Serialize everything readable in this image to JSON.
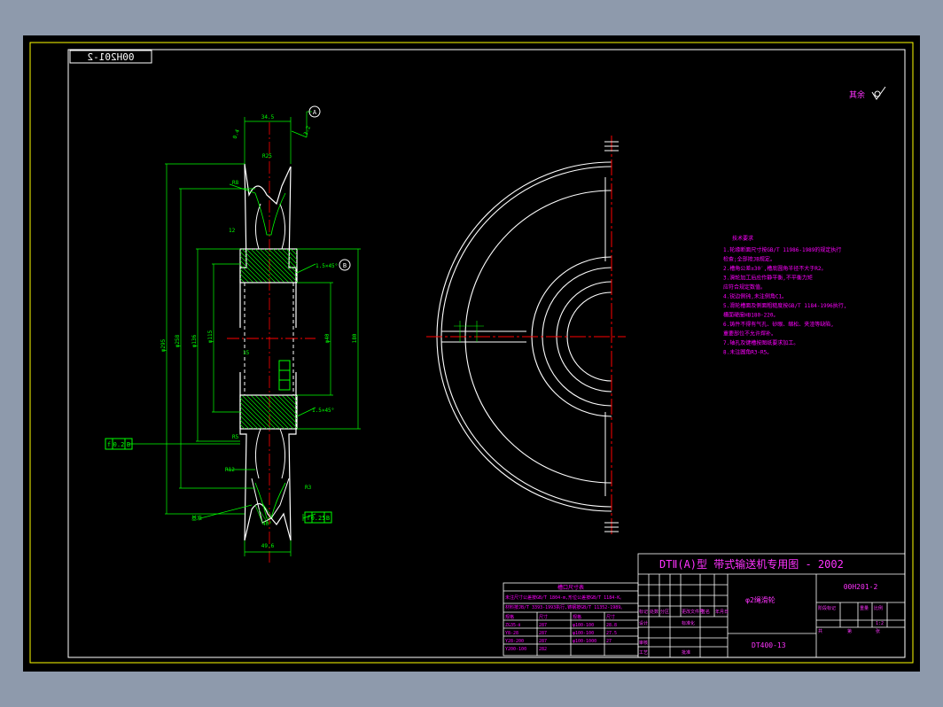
{
  "colors": {
    "background": "#8e9aac",
    "canvas": "#000000",
    "frame": "#ffff00",
    "outline": "#ffffff",
    "dimension": "#00ff00",
    "centerline": "#ff0000",
    "hatch": "#00ff00",
    "title_text": "#ff33ff",
    "notes_text": "#ff00ff"
  },
  "drawing": {
    "code_box": "00H201-2",
    "roughness_symbol_label": "其余",
    "datum_a": "A",
    "datum_b": "B",
    "gauge_label": "基准",
    "notes_title": "技术要求",
    "notes": [
      "1.轮缘断面尺寸按GB/T 11986-1989的规定执行",
      "  检查;全部按JB规定。",
      "2.槽角公差±30′,槽底圆角半径不大于R2。",
      "3.滑轮加工后应作静平衡,不平衡力矩",
      "  应符合规定数值。",
      "4.锐边倒钝,未注倒角C1。",
      "5.滑轮槽面及侧面粗糙度按GB/T 1184-1996执行,",
      "  槽面硬度HB180-220。",
      "6.铸件不得有气孔、砂眼、缩松、夹渣等缺陷,",
      "  重要部位不允许焊补。",
      "7.轴孔及键槽按图纸要求加工。",
      "8.未注圆角R3-R5。"
    ],
    "table_title": "槽口尺寸表",
    "table_notes": [
      "未注尺寸公差按GB/T 1804-m,形位公差按GB/T 1184-K。",
      "材料按JB/T 3393-1993执行,铸钢按GB/T 11352-1989。"
    ],
    "table_headers": [
      "规格",
      "尺寸",
      "规格",
      "尺寸"
    ],
    "table_rows": [
      [
        "ZG35-Ⅱ",
        "287",
        "φ100-100",
        "28.8"
      ],
      [
        "Y8-28",
        "287",
        "φ100-100",
        "27.5"
      ],
      [
        "Y28-200",
        "287",
        "φ100-1000",
        "27"
      ],
      [
        "Y200-100",
        "282",
        ""
      ]
    ],
    "title_main": "DTⅡ(A)型  带式输送机专用图 - 2002",
    "drawing_number": "00H201-2",
    "part_name": "φ2绳滑轮",
    "model_code": "DT400-13",
    "scale": "1:2",
    "title_labels": {
      "mark": "标记",
      "count": "处数",
      "zone": "分区",
      "change_doc": "更改文件号",
      "signature": "签名",
      "date": "年月日",
      "design": "设计",
      "standardize": "标准化",
      "check": "审核",
      "process": "工艺",
      "approve": "批准",
      "stage": "阶段标记",
      "weight": "重量",
      "ratio": "比例",
      "sheet": "共",
      "sheet_of": "第",
      "page": "张"
    },
    "dims": {
      "top_width": "34.5",
      "top_r": "R25",
      "r5": "R5",
      "r8": "R8",
      "dia_outer": "φ295",
      "dia_groove": "φ258",
      "dia_hub": "φ136",
      "dia_inner": "φ115",
      "dia_bore": "φ40",
      "dia_180": "180",
      "hub_len": "15",
      "chamfer1": "1.5×45°",
      "chamfer2": "1.5×45°",
      "keyway": "12",
      "angle": "40°",
      "bottom_width": "49.6",
      "r12": "R12",
      "r3": "R3",
      "left_box": [
        "f",
        "0.2",
        "B"
      ],
      "right_box": [
        "f",
        "0.25",
        "B"
      ],
      "tol_left": "0.4",
      "tol_right": "3.2"
    }
  }
}
